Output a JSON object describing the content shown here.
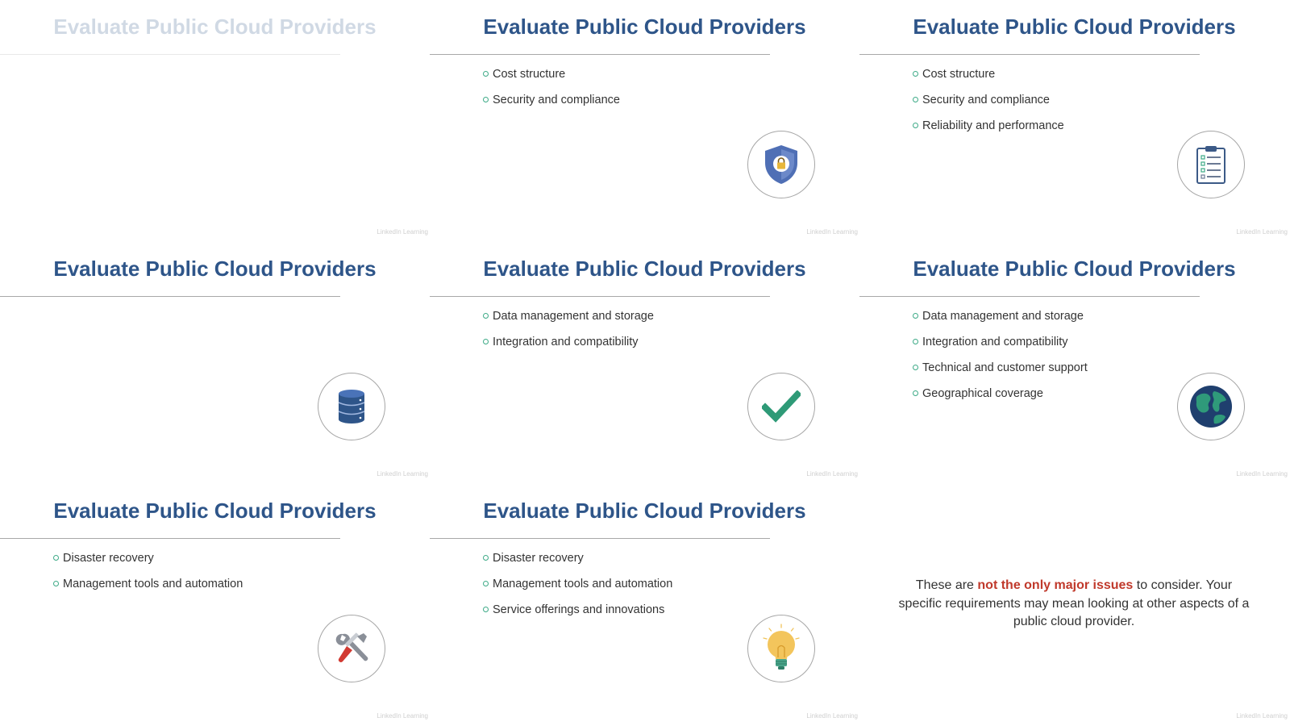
{
  "slides": [
    {
      "title": "Evaluate Public Cloud Providers",
      "bullets": [],
      "icon": "none",
      "watermark": "LinkedIn Learning"
    },
    {
      "title": "Evaluate Public Cloud Providers",
      "bullets": [
        "Cost structure",
        "Security and compliance"
      ],
      "icon": "shield-lock-icon",
      "watermark": "LinkedIn Learning"
    },
    {
      "title": "Evaluate Public Cloud Providers",
      "bullets": [
        "Cost structure",
        "Security and compliance",
        "Reliability and performance"
      ],
      "icon": "clipboard-checklist-icon",
      "watermark": "LinkedIn Learning"
    },
    {
      "title": "Evaluate Public Cloud Providers",
      "bullets": [],
      "icon": "database-icon",
      "watermark": "LinkedIn Learning"
    },
    {
      "title": "Evaluate Public Cloud Providers",
      "bullets": [
        "Data management and storage",
        "Integration and compatibility"
      ],
      "icon": "checkmark-icon",
      "watermark": "LinkedIn Learning"
    },
    {
      "title": "Evaluate Public Cloud Providers",
      "bullets": [
        "Data management and storage",
        "Integration and compatibility",
        "Technical and customer support",
        "Geographical coverage"
      ],
      "icon": "globe-icon",
      "watermark": "LinkedIn Learning"
    },
    {
      "title": "Evaluate Public Cloud Providers",
      "bullets": [
        "Disaster recovery",
        "Management tools and automation"
      ],
      "icon": "tools-icon",
      "watermark": "LinkedIn Learning"
    },
    {
      "title": "Evaluate Public Cloud Providers",
      "bullets": [
        "Disaster recovery",
        "Management tools and automation",
        "Service offerings and innovations"
      ],
      "icon": "lightbulb-icon",
      "watermark": "LinkedIn Learning"
    }
  ],
  "closing": {
    "text_before": "These are ",
    "highlight": "not the only major issues",
    "text_after": " to consider. Your specific requirements may mean looking at other aspects of a public cloud provider.",
    "highlight_color": "#c0392b",
    "watermark": "LinkedIn Learning"
  },
  "colors": {
    "title": "#2e5589",
    "bullet_marker": "#3daa87",
    "body_text": "#333333",
    "rule": "#a9a9a9"
  }
}
